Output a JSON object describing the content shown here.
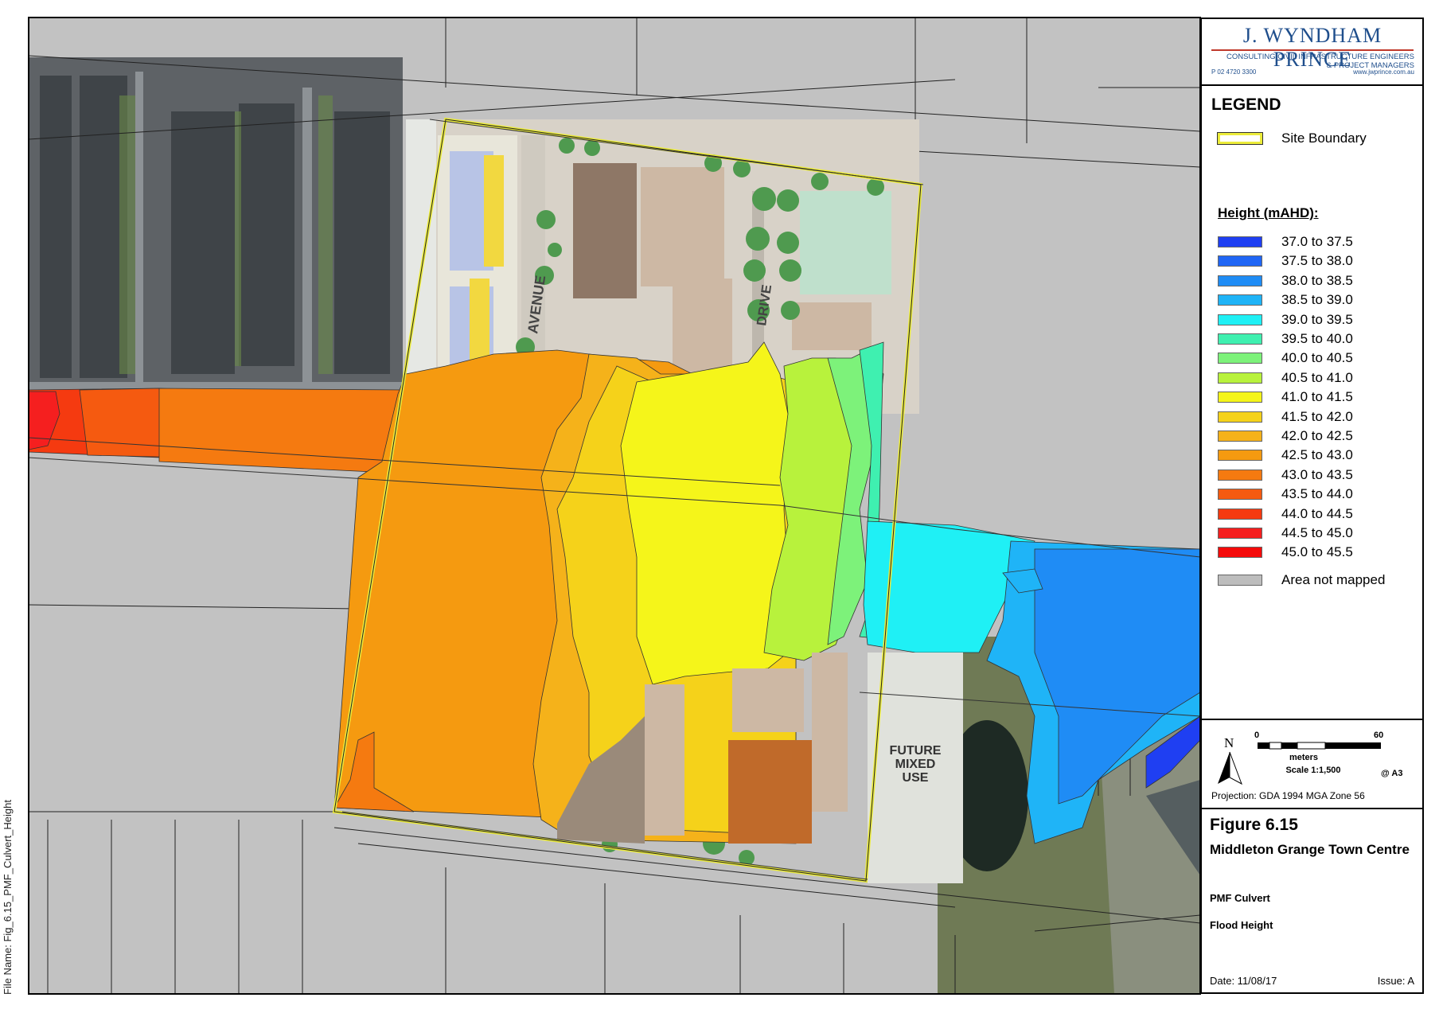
{
  "file_name": "File Name: Fig_6.15_PMF_Culvert_Height",
  "logo": {
    "name": "J. WYNDHAM PRINCE",
    "tagline1": "CONSULTING CIVIL INFRASTRUCTURE ENGINEERS",
    "tagline2": "& PROJECT MANAGERS",
    "phone": "P 02 4720 3300",
    "web": "www.jwprince.com.au"
  },
  "legend": {
    "title": "LEGEND",
    "site_boundary": "Site Boundary",
    "height_title": "Height (mAHD):",
    "classes": [
      {
        "label": "37.0 to 37.5",
        "color": "#1f3ff2"
      },
      {
        "label": "37.5 to 38.0",
        "color": "#2066f5"
      },
      {
        "label": "38.0 to 38.5",
        "color": "#1f8cf5"
      },
      {
        "label": "38.5 to 39.0",
        "color": "#1fb4f7"
      },
      {
        "label": "39.0 to 39.5",
        "color": "#1ff0f5"
      },
      {
        "label": "39.5 to 40.0",
        "color": "#3ff0b0"
      },
      {
        "label": "40.0 to 40.5",
        "color": "#7df27a"
      },
      {
        "label": "40.5 to 41.0",
        "color": "#b8f23c"
      },
      {
        "label": "41.0 to 41.5",
        "color": "#f5f51a"
      },
      {
        "label": "41.5 to 42.0",
        "color": "#f5d21a"
      },
      {
        "label": "42.0 to 42.5",
        "color": "#f5b21a"
      },
      {
        "label": "42.5 to 43.0",
        "color": "#f59a10"
      },
      {
        "label": "43.0 to 43.5",
        "color": "#f57a10"
      },
      {
        "label": "43.5 to 44.0",
        "color": "#f55a10"
      },
      {
        "label": "44.0 to 44.5",
        "color": "#f53a10"
      },
      {
        "label": "44.5 to 45.0",
        "color": "#f51f1f"
      },
      {
        "label": "45.0 to 45.5",
        "color": "#f50a0a"
      }
    ],
    "not_mapped": {
      "label": "Area not mapped",
      "color": "#bdbdbd"
    }
  },
  "scale": {
    "north": "N",
    "start": "0",
    "end": "60",
    "unit": "meters",
    "ratio": "Scale 1:1,500",
    "paper": "@ A3"
  },
  "projection": "Projection: GDA 1994 MGA Zone 56",
  "figure": {
    "number": "Figure 6.15",
    "title": "Middleton Grange Town Centre",
    "subtitle1": "PMF Culvert",
    "subtitle2": "Flood Height",
    "date": "Date: 11/08/17",
    "issue": "Issue: A"
  },
  "map_labels": {
    "avenue": "AVENUE",
    "drive": "DRIVE",
    "future_1": "FUTURE",
    "future_2": "MIXED",
    "future_3": "USE"
  }
}
